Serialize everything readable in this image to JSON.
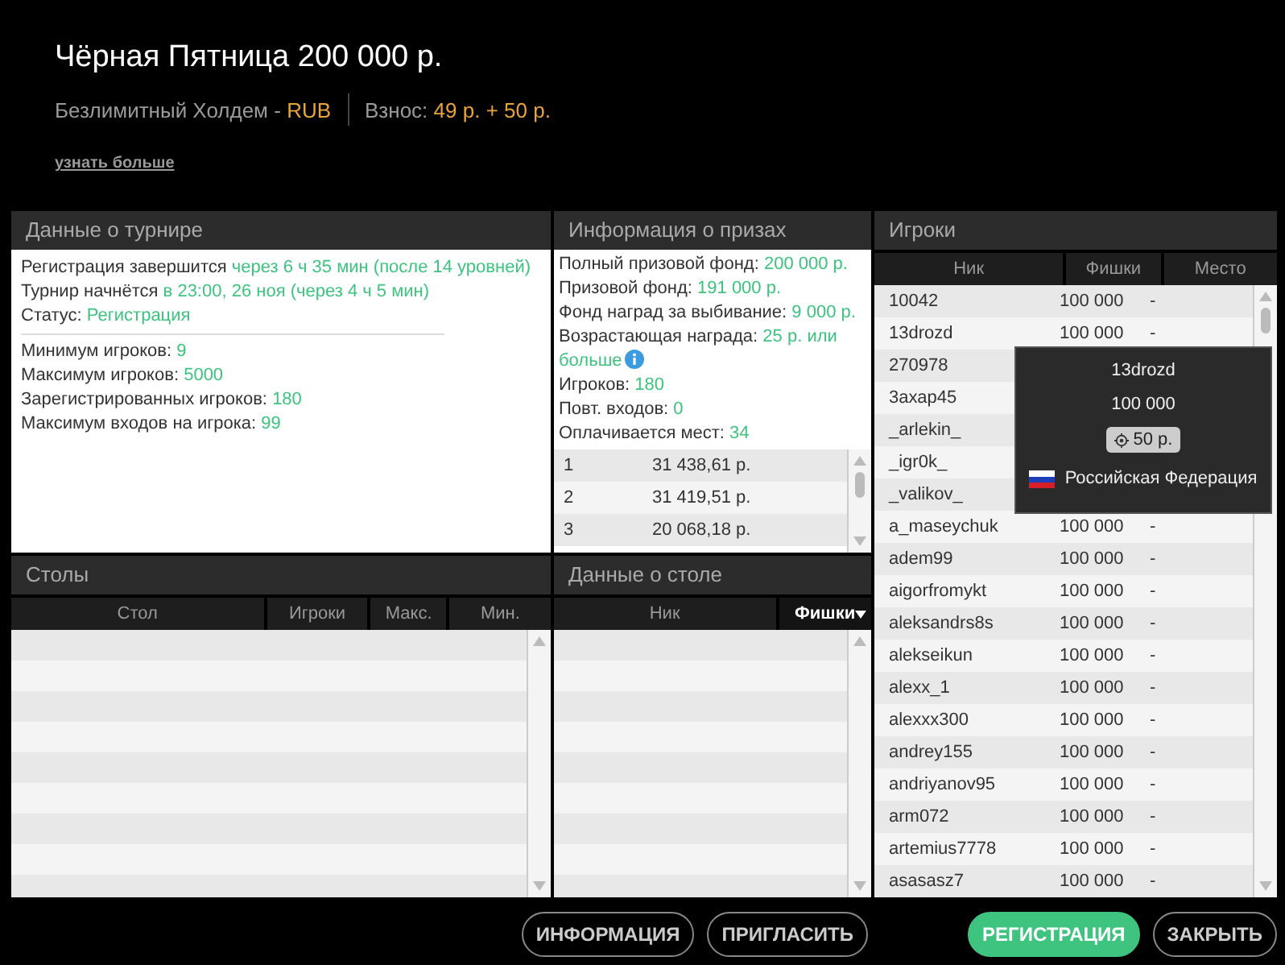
{
  "header": {
    "title": "Чёрная Пятница 200 000 р.",
    "game": "Безлимитный Холдем -",
    "currency": "RUB",
    "buyin_label": "Взнос:",
    "buyin": "49 р. + 50 р.",
    "more_link": "узнать больше"
  },
  "tournament": {
    "title": "Данные о турнире",
    "sections": [
      [
        {
          "label": "Регистрация завершится",
          "value": "через 6 ч 35 мин (после 14 уровней)"
        },
        {
          "label": "Турнир начнётся",
          "value": "в 23:00, 26 ноя (через 4 ч 5 мин)"
        },
        {
          "label": "Статус:",
          "value": "Регистрация"
        }
      ],
      [
        {
          "label": "Минимум игроков:",
          "value": "9"
        },
        {
          "label": "Максимум игроков:",
          "value": "5000"
        },
        {
          "label": "Зарегистрированных игроков:",
          "value": "180"
        },
        {
          "label": "Максимум входов на игрока:",
          "value": "99"
        }
      ]
    ]
  },
  "prizes": {
    "title": "Информация о призах",
    "lines": [
      {
        "label": "Полный призовой фонд:",
        "value": "200 000 р."
      },
      {
        "label": "Призовой фонд:",
        "value": "191 000 р."
      },
      {
        "label": "Фонд наград за выбивание:",
        "value": "9 000 р."
      },
      {
        "label": "Возрастающая награда:",
        "value": "25 р. или",
        "continuation": "больше",
        "info": true
      },
      {
        "label": "Игроков:",
        "value": "180"
      },
      {
        "label": "Повт. входов:",
        "value": "0"
      },
      {
        "label": "Оплачивается мест:",
        "value": "34"
      }
    ],
    "places": [
      {
        "place": "1",
        "amount": "31 438,61 р."
      },
      {
        "place": "2",
        "amount": "31 419,51 р."
      },
      {
        "place": "3",
        "amount": "20 068,18 р."
      }
    ]
  },
  "tables": {
    "title": "Столы",
    "columns": [
      "Стол",
      "Игроки",
      "Макс.",
      "Мин."
    ]
  },
  "table_details": {
    "title": "Данные о столе",
    "columns": [
      {
        "label": "Ник",
        "sorted": false
      },
      {
        "label": "Фишки",
        "sorted": true
      }
    ]
  },
  "players": {
    "title": "Игроки",
    "columns": [
      "Ник",
      "Фишки",
      "Место"
    ],
    "rows": [
      {
        "nick": "10042",
        "chips": "100 000",
        "place": "-"
      },
      {
        "nick": "13drozd",
        "chips": "100 000",
        "place": "-"
      },
      {
        "nick": "270978"
      },
      {
        "nick": "3ахар45"
      },
      {
        "nick": "_arlekin_"
      },
      {
        "nick": "_igr0k_"
      },
      {
        "nick": "_valikov_"
      },
      {
        "nick": "a_maseychuk",
        "chips": "100 000",
        "place": "-"
      },
      {
        "nick": "adem99",
        "chips": "100 000",
        "place": "-"
      },
      {
        "nick": "aigorfromykt",
        "chips": "100 000",
        "place": "-"
      },
      {
        "nick": "aleksandrs8s",
        "chips": "100 000",
        "place": "-"
      },
      {
        "nick": "alekseikun",
        "chips": "100 000",
        "place": "-"
      },
      {
        "nick": "alexx_1",
        "chips": "100 000",
        "place": "-"
      },
      {
        "nick": "alexxx300",
        "chips": "100 000",
        "place": "-"
      },
      {
        "nick": "andrey155",
        "chips": "100 000",
        "place": "-"
      },
      {
        "nick": "andriyanov95",
        "chips": "100 000",
        "place": "-"
      },
      {
        "nick": "arm072",
        "chips": "100 000",
        "place": "-"
      },
      {
        "nick": "artemius7778",
        "chips": "100 000",
        "place": "-"
      },
      {
        "nick": "asasasz7",
        "chips": "100 000",
        "place": "-"
      }
    ],
    "tooltip": {
      "nick": "13drozd",
      "chips": "100 000",
      "bounty": "50 р.",
      "country": "Российская Федерация"
    }
  },
  "buttons": [
    {
      "label": "ИНФОРМАЦИЯ",
      "kind": "outline"
    },
    {
      "label": "ПРИГЛАСИТЬ",
      "kind": "outline"
    },
    {
      "label": "РЕГИСТРАЦИЯ",
      "kind": "primary"
    },
    {
      "label": "ЗАКРЫТЬ",
      "kind": "outline"
    }
  ]
}
